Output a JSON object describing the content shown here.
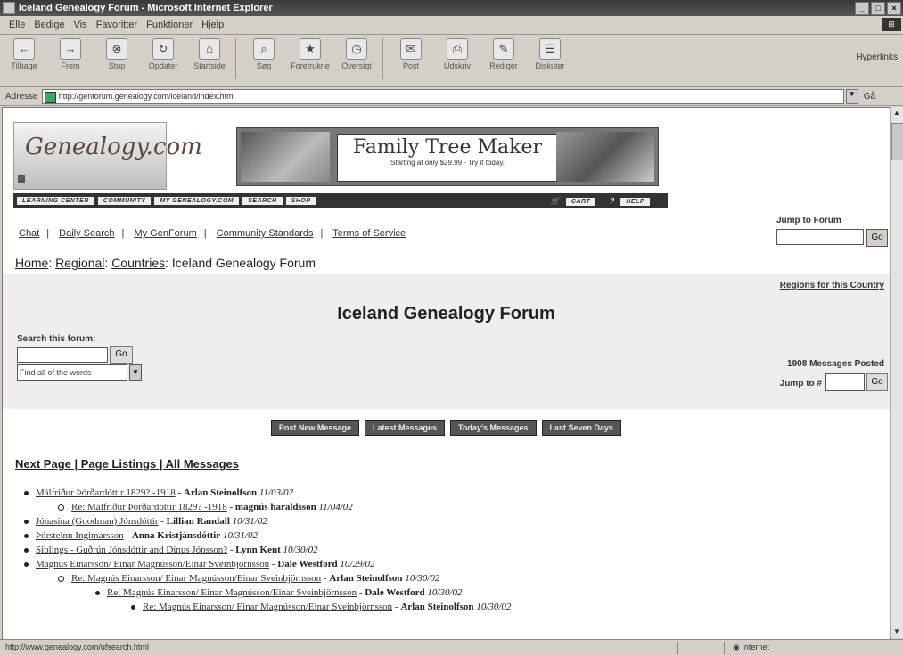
{
  "window": {
    "title": "Iceland Genealogy Forum - Microsoft Internet Explorer"
  },
  "menu": [
    "Elle",
    "Bedige",
    "Vis",
    "Favoritter",
    "Funktioner",
    "Hjelp"
  ],
  "toolbar": {
    "buttons": [
      {
        "label": "Tilbage",
        "icon": "back-arrow-icon"
      },
      {
        "label": "Frem",
        "icon": "forward-arrow-icon"
      },
      {
        "label": "Stop",
        "icon": "stop-icon"
      },
      {
        "label": "Opdater",
        "icon": "refresh-icon"
      },
      {
        "label": "Startside",
        "icon": "home-icon"
      },
      {
        "label": "Søg",
        "icon": "search-icon"
      },
      {
        "label": "Foretrukne",
        "icon": "favorites-icon"
      },
      {
        "label": "Oversigt",
        "icon": "history-icon"
      },
      {
        "label": "Post",
        "icon": "mail-icon"
      },
      {
        "label": "Udskriv",
        "icon": "print-icon"
      },
      {
        "label": "Rediger",
        "icon": "edit-icon"
      },
      {
        "label": "Diskuter",
        "icon": "discuss-icon"
      }
    ],
    "links_label": "Hyperlinks"
  },
  "address": {
    "label": "Adresse",
    "url": "http://genforum.genealogy.com/iceland/index.html",
    "go": "Gå"
  },
  "banner": {
    "logo": "Genealogy.com",
    "ad_title": "Family Tree Maker",
    "ad_sub": "Starting at only $29.99 - Try it today.",
    "nav": [
      "LEARNING CENTER",
      "COMMUNITY",
      "MY GENEALOGY.COM",
      "SEARCH",
      "SHOP"
    ],
    "cart": "CART",
    "help": "HELP"
  },
  "toplinks": [
    "Chat",
    "Daily Search",
    "My GenForum",
    "Community Standards",
    "Terms of Service"
  ],
  "jump_forum": {
    "label": "Jump to Forum",
    "go": "Go"
  },
  "breadcrumbs": [
    "Home",
    "Regional",
    "Countries",
    "Iceland Genealogy Forum"
  ],
  "forum": {
    "regions_link": "Regions for this Country",
    "title": "Iceland Genealogy Forum",
    "search_label": "Search this forum:",
    "search_go": "Go",
    "search_mode": "Find all of the words",
    "messages_posted": "1908 Messages Posted",
    "jump_label": "Jump to #",
    "jump_go": "Go"
  },
  "actions": [
    "Post New Message",
    "Latest Messages",
    "Today's Messages",
    "Last Seven Days"
  ],
  "next_links": "Next Page | Page Listings | All Messages",
  "messages": [
    {
      "subject": "Málfríður Þórðardóttir 1829? -1918",
      "author": "Arlan Steinolfson",
      "date": "11/03/02",
      "level": 0
    },
    {
      "subject": "Re: Málfríður Þórðardóttir 1829? -1918",
      "author": "magnús haraldsson",
      "date": "11/04/02",
      "level": 1
    },
    {
      "subject": "Jónasína (Goodman) Jónsdóttir",
      "author": "Lillian Randall",
      "date": "10/31/02",
      "level": 0
    },
    {
      "subject": "Þórsteinn Ingimarsson",
      "author": "Anna Kristjánsdóttir",
      "date": "10/31/02",
      "level": 0
    },
    {
      "subject": "Siblings - Guðrún Jónsdóttir and Dínus Jónsson?",
      "author": "Lynn Kent",
      "date": "10/30/02",
      "level": 0
    },
    {
      "subject": "Magnús Einarsson/ Einar Magnússon/Einar Sveinbjörnsson",
      "author": "Dale Westford",
      "date": "10/29/02",
      "level": 0
    },
    {
      "subject": "Re: Magnús Einarsson/ Einar Magnússon/Einar Sveinbjörnsson",
      "author": "Arlan Steinolfson",
      "date": "10/30/02",
      "level": 1
    },
    {
      "subject": "Re: Magnús Einarsson/ Einar Magnússon/Einar Sveinbjörnsson",
      "author": "Dale Westford",
      "date": "10/30/02",
      "level": 2
    },
    {
      "subject": "Re: Magnús Einarsson/ Einar Magnússon/Einar Sveinbjörnsson",
      "author": "Arlan Steinolfson",
      "date": "10/30/02",
      "level": 3
    }
  ],
  "status": {
    "url": "http://www.genealogy.com/ufsearch.html",
    "zone": "Internet"
  }
}
